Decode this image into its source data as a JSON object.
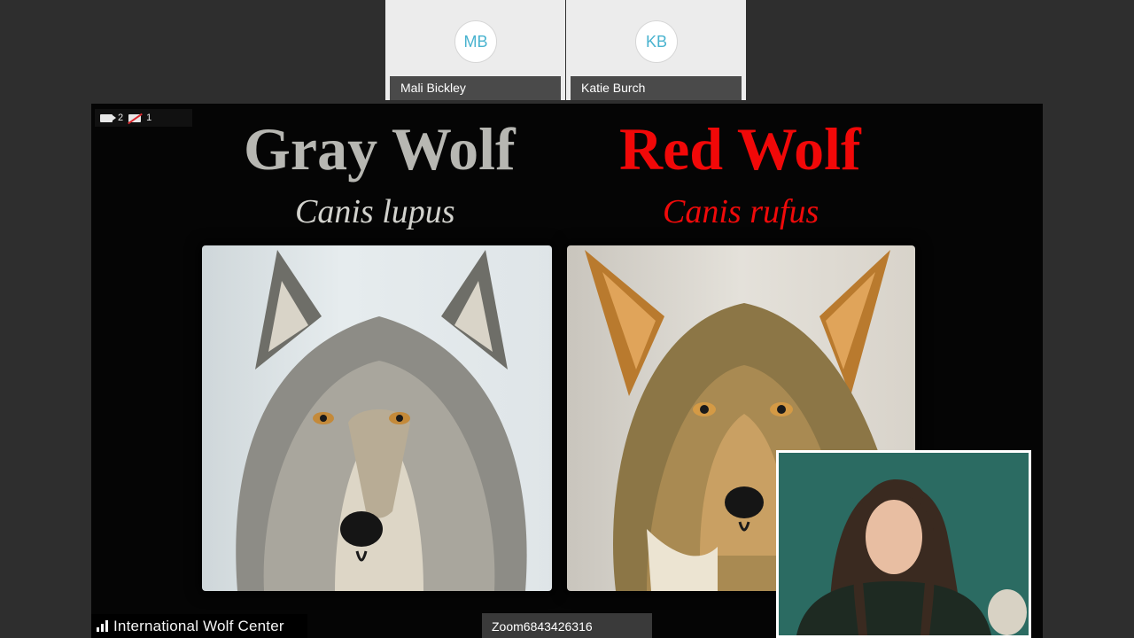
{
  "participants": [
    {
      "initials": "MB",
      "name": "Mali Bickley"
    },
    {
      "initials": "KB",
      "name": "Katie Burch"
    }
  ],
  "share": {
    "video_count": "2",
    "video_off_count": "1",
    "gray": {
      "title": "Gray Wolf",
      "scientific": "Canis lupus"
    },
    "red": {
      "title": "Red Wolf",
      "scientific": "Canis rufus"
    },
    "logo_text": "International Wolf Center"
  },
  "meeting_id": "Zoom6843426316",
  "colors": {
    "gray_title": "#b7b7b2",
    "red_title": "#f10808",
    "avatar_text": "#49b3cf",
    "pip_background": "#2b6b62"
  },
  "icons": [
    "video-camera-icon",
    "video-off-icon",
    "signal-bars-icon",
    "gray-wolf-image",
    "red-wolf-image"
  ]
}
